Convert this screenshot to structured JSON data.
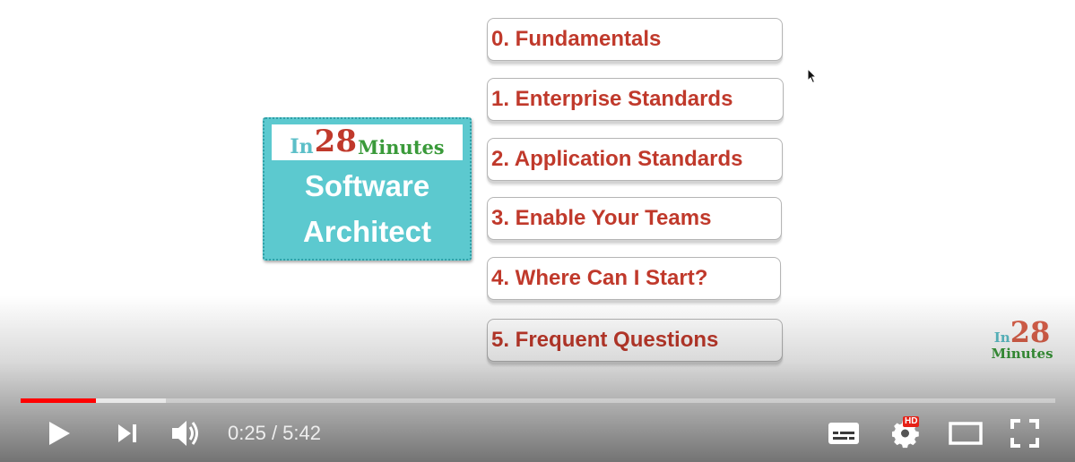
{
  "logo_card": {
    "brand_in": "In",
    "brand_num": "28",
    "brand_min": "Minutes",
    "line1": "Software",
    "line2": "Architect"
  },
  "agenda": [
    {
      "label": "0. Fundamentals"
    },
    {
      "label": "1. Enterprise Standards"
    },
    {
      "label": "2. Application Standards"
    },
    {
      "label": "3. Enable Your Teams"
    },
    {
      "label": "4. Where Can I Start?"
    },
    {
      "label": "5. Frequent Questions"
    }
  ],
  "watermark": {
    "in": "In",
    "num": "28",
    "min": "Minutes"
  },
  "player": {
    "current_time": "0:25",
    "separator": " / ",
    "duration": "5:42",
    "progress_played": 0.073,
    "progress_buffered": 0.14,
    "quality_badge": "HD",
    "accent_color": "#ff0000",
    "icons": [
      "play-icon",
      "next-icon",
      "volume-icon",
      "subtitles-icon",
      "settings-icon",
      "theater-mode-icon",
      "fullscreen-icon"
    ]
  }
}
